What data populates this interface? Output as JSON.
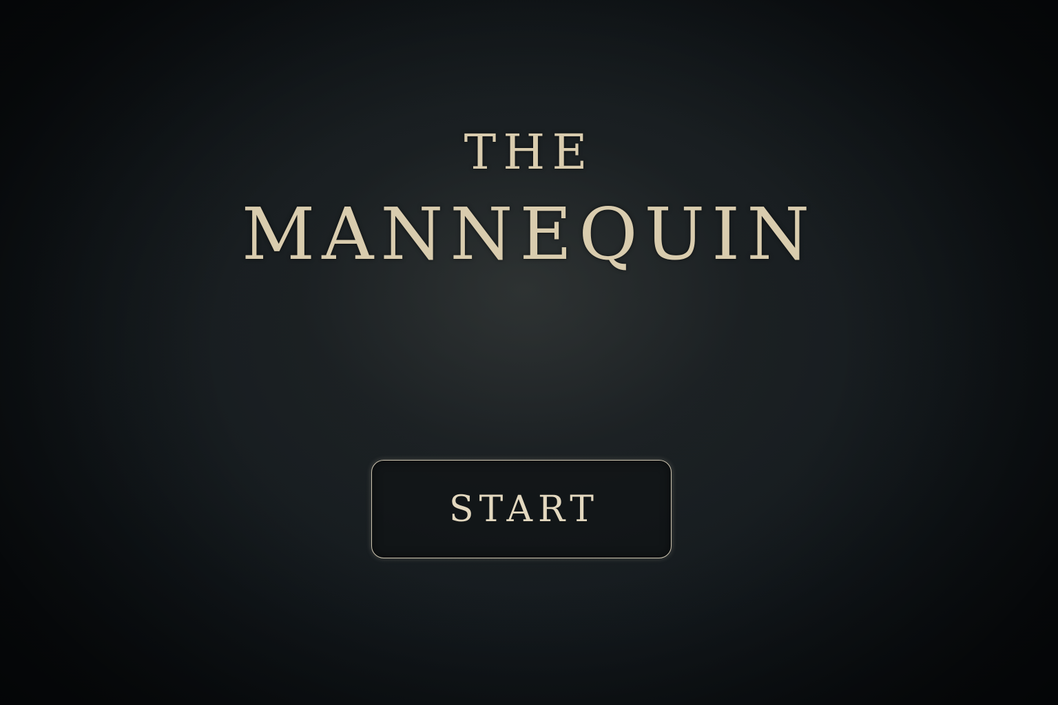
{
  "title": {
    "line1": "THE",
    "line2": "MANNEQUIN"
  },
  "menu": {
    "start_label": "START"
  },
  "colors": {
    "text": "#d9ccae",
    "background": "#12171b",
    "button_border": "#cfc6b1"
  }
}
